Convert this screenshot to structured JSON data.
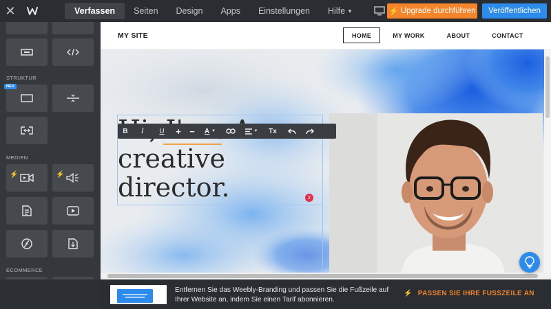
{
  "topbar": {
    "tabs": [
      {
        "label": "Verfassen"
      },
      {
        "label": "Seiten"
      },
      {
        "label": "Design"
      },
      {
        "label": "Apps"
      },
      {
        "label": "Einstellungen"
      },
      {
        "label": "Hilfe"
      }
    ],
    "upgrade_label": "Upgrade durchführen",
    "publish_label": "Veröffentlichen",
    "colors": {
      "upgrade": "#f5852a",
      "publish": "#2d8ceb"
    }
  },
  "sidebar": {
    "sections": [
      {
        "label": "STRUKTUR",
        "badge": "NEU"
      },
      {
        "label": "MEDIEN"
      },
      {
        "label": "ECOMMERCE"
      }
    ],
    "tiles": [
      {
        "icon": "partial-tile-icon"
      },
      {
        "icon": "partial-tile-icon"
      },
      {
        "icon": "button-icon"
      },
      {
        "icon": "embed-code-icon"
      },
      {
        "icon": "section-icon"
      },
      {
        "icon": "divider-icon"
      },
      {
        "icon": "spacer-icon"
      },
      {
        "icon": "video-icon"
      },
      {
        "icon": "audio-icon"
      },
      {
        "icon": "document-icon"
      },
      {
        "icon": "youtube-icon"
      },
      {
        "icon": "flash-icon"
      },
      {
        "icon": "file-download-icon"
      },
      {
        "icon": "product-grid-icon"
      },
      {
        "icon": "product-list-icon"
      }
    ]
  },
  "site": {
    "title": "MY SITE",
    "nav": [
      {
        "label": "HOME"
      },
      {
        "label": "MY WORK"
      },
      {
        "label": "ABOUT"
      },
      {
        "label": "CONTACT"
      }
    ],
    "hero_lines": [
      "Hi, I'm . A",
      "creative",
      "director."
    ],
    "badge_count": "2"
  },
  "editor_toolbar": {
    "tools": [
      {
        "label": "B",
        "name": "bold-button"
      },
      {
        "label": "I",
        "name": "italic-button"
      },
      {
        "label": "U",
        "name": "underline-button"
      },
      {
        "label": "+",
        "name": "increase-size-button"
      },
      {
        "label": "−",
        "name": "decrease-size-button"
      },
      {
        "label": "A",
        "name": "text-color-button"
      },
      {
        "name": "link-button"
      },
      {
        "name": "align-button"
      },
      {
        "label": "Tx",
        "name": "clear-format-button"
      },
      {
        "name": "undo-button"
      },
      {
        "name": "redo-button"
      }
    ]
  },
  "footer": {
    "message": "Entfernen Sie das Weebly-Branding und passen Sie die Fußzeile auf Ihrer Website an, indem Sie einen Tarif abonnieren.",
    "cta": "PASSEN SIE IHRE FUSSZEILE AN"
  }
}
